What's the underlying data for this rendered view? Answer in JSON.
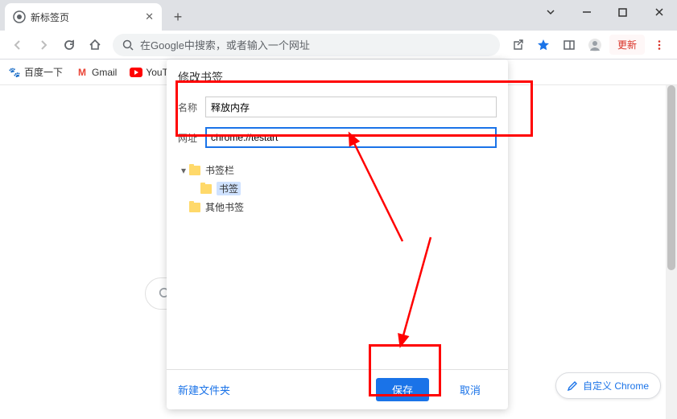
{
  "tab": {
    "title": "新标签页"
  },
  "omnibox": {
    "placeholder": "在Google中搜索，或者输入一个网址"
  },
  "toolbar": {
    "update_label": "更新"
  },
  "bookmarks": [
    {
      "label": "百度一下",
      "icon": "paw"
    },
    {
      "label": "Gmail",
      "icon": "M"
    },
    {
      "label": "YouT...",
      "icon": "yt"
    }
  ],
  "dialog": {
    "title": "修改书签",
    "name_label": "名称",
    "name_value": "释放内存",
    "url_label": "网址",
    "url_value": "chrome://testart",
    "tree": {
      "root": "书签栏",
      "child": "书签",
      "other": "其他书签"
    },
    "new_folder": "新建文件夹",
    "save": "保存",
    "cancel": "取消"
  },
  "customize": {
    "label": "自定义 Chrome"
  }
}
